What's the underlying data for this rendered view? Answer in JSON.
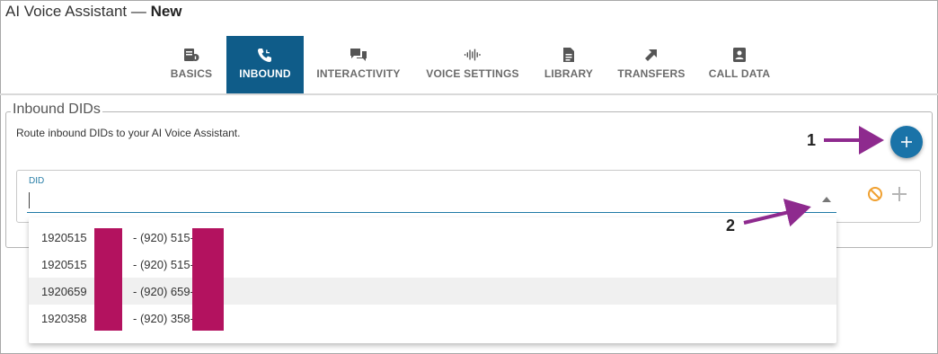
{
  "window": {
    "title_prefix": "AI Voice Assistant — ",
    "title_status": "New"
  },
  "tabs": [
    {
      "label": "BASICS",
      "icon": "basics-icon",
      "active": false
    },
    {
      "label": "INBOUND",
      "icon": "inbound-call-icon",
      "active": true
    },
    {
      "label": "INTERACTIVITY",
      "icon": "chat-bubbles-icon",
      "active": false
    },
    {
      "label": "VOICE SETTINGS",
      "icon": "audio-wave-icon",
      "active": false
    },
    {
      "label": "LIBRARY",
      "icon": "document-icon",
      "active": false
    },
    {
      "label": "TRANSFERS",
      "icon": "transfer-arrow-icon",
      "active": false
    },
    {
      "label": "CALL DATA",
      "icon": "contact-card-icon",
      "active": false
    }
  ],
  "section": {
    "legend": "Inbound DIDs",
    "description": "Route inbound DIDs to your AI Voice Assistant."
  },
  "did_field": {
    "label": "DID",
    "value": ""
  },
  "dropdown": {
    "options": [
      {
        "number": "1920515",
        "display": "- (920) 515-"
      },
      {
        "number": "1920515",
        "display": "- (920) 515-"
      },
      {
        "number": "1920659",
        "display": "- (920) 659-"
      },
      {
        "number": "1920358",
        "display": "- (920) 358-"
      }
    ],
    "hovered_index": 2
  },
  "callouts": {
    "one": "1",
    "two": "2"
  },
  "colors": {
    "active_tab": "#0f5c89",
    "fab": "#1a73a8",
    "callout_arrow": "#8e2a8e",
    "redaction": "#b3125f",
    "clear_icon": "#f0a030"
  }
}
